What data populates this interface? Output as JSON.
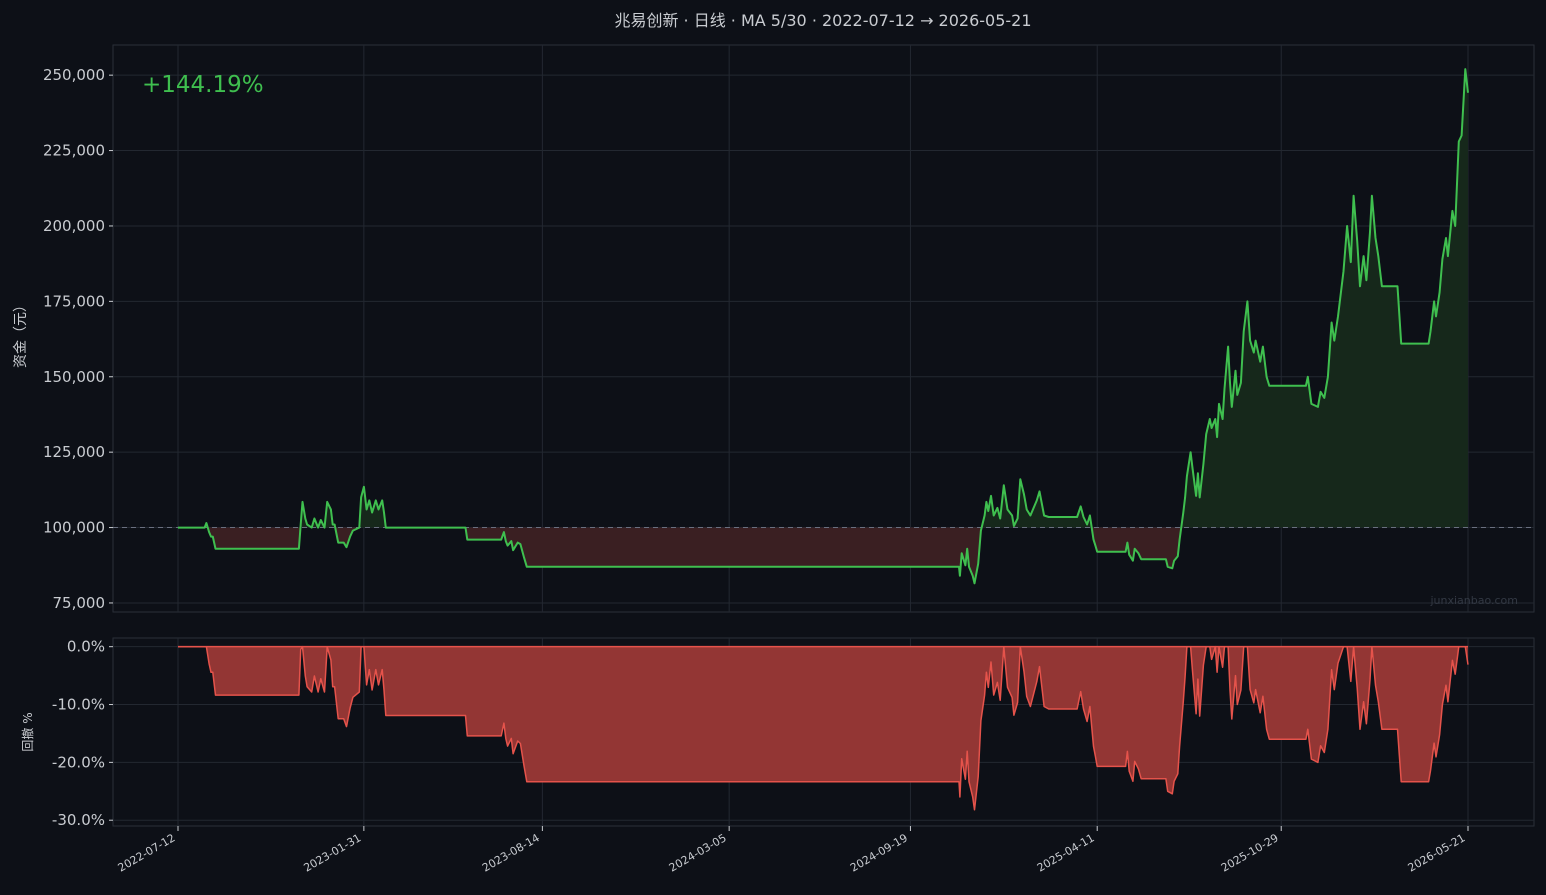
{
  "title": "兆易创新 · 日线 · MA 5/30 · 2022-07-12 → 2026-05-21",
  "return_label": "+144.19%",
  "watermark": "junxianbao.com",
  "colors": {
    "background": "#0d1017",
    "equity_line": "#3fbf4f",
    "gain_fill": "#16281b",
    "loss_fill": "#3a1f22",
    "drawdown": "#e5534b",
    "drawdown_fill": "#933634",
    "grid": "#232831",
    "text": "#c9ccd1",
    "baseline": "#6a7080"
  },
  "chart_data": [
    {
      "type": "line",
      "name": "equity",
      "ylabel": "资金（元）",
      "ylim": [
        72000,
        260000
      ],
      "yticks": [
        75000,
        100000,
        125000,
        150000,
        175000,
        200000,
        225000,
        250000
      ],
      "ytick_labels": [
        "75,000",
        "100,000",
        "125,000",
        "150,000",
        "175,000",
        "200,000",
        "225,000",
        "250,000"
      ],
      "baseline": 100000,
      "x_start": "2022-07-12",
      "x_end": "2026-05-21",
      "points": [
        [
          "2022-07-12",
          100000
        ],
        [
          "2022-08-10",
          100000
        ],
        [
          "2022-08-12",
          101500
        ],
        [
          "2022-08-15",
          98500
        ],
        [
          "2022-08-17",
          97000
        ],
        [
          "2022-08-19",
          97000
        ],
        [
          "2022-08-22",
          93000
        ],
        [
          "2022-11-21",
          93000
        ],
        [
          "2022-11-23",
          101000
        ],
        [
          "2022-11-25",
          108500
        ],
        [
          "2022-11-28",
          103000
        ],
        [
          "2022-11-30",
          101000
        ],
        [
          "2022-12-05",
          100000
        ],
        [
          "2022-12-08",
          103000
        ],
        [
          "2022-12-12",
          100000
        ],
        [
          "2022-12-15",
          102500
        ],
        [
          "2022-12-19",
          100000
        ],
        [
          "2022-12-22",
          108500
        ],
        [
          "2022-12-26",
          106000
        ],
        [
          "2022-12-28",
          101000
        ],
        [
          "2022-12-30",
          101000
        ],
        [
          "2023-01-03",
          95000
        ],
        [
          "2023-01-09",
          95000
        ],
        [
          "2023-01-12",
          93500
        ],
        [
          "2023-01-16",
          97000
        ],
        [
          "2023-01-19",
          99000
        ],
        [
          "2023-01-26",
          100000
        ],
        [
          "2023-01-28",
          110000
        ],
        [
          "2023-01-31",
          113500
        ],
        [
          "2023-02-03",
          106000
        ],
        [
          "2023-02-06",
          109000
        ],
        [
          "2023-02-09",
          105000
        ],
        [
          "2023-02-13",
          109000
        ],
        [
          "2023-02-16",
          106000
        ],
        [
          "2023-02-20",
          109000
        ],
        [
          "2023-02-22",
          105000
        ],
        [
          "2023-02-24",
          100000
        ],
        [
          "2023-05-22",
          100000
        ],
        [
          "2023-05-24",
          96000
        ],
        [
          "2023-06-30",
          96000
        ],
        [
          "2023-07-03",
          98500
        ],
        [
          "2023-07-05",
          95500
        ],
        [
          "2023-07-07",
          94000
        ],
        [
          "2023-07-11",
          95500
        ],
        [
          "2023-07-13",
          92500
        ],
        [
          "2023-07-18",
          95000
        ],
        [
          "2023-07-21",
          94500
        ],
        [
          "2023-07-25",
          90000
        ],
        [
          "2023-07-28",
          87000
        ],
        [
          "2023-08-01",
          87000
        ],
        [
          "2024-11-11",
          87000
        ],
        [
          "2024-11-12",
          84000
        ],
        [
          "2024-11-14",
          91500
        ],
        [
          "2024-11-18",
          87500
        ],
        [
          "2024-11-20",
          93000
        ],
        [
          "2024-11-22",
          87000
        ],
        [
          "2024-11-26",
          84000
        ],
        [
          "2024-11-28",
          81500
        ],
        [
          "2024-12-02",
          88000
        ],
        [
          "2024-12-05",
          99000
        ],
        [
          "2024-12-09",
          104000
        ],
        [
          "2024-12-11",
          108500
        ],
        [
          "2024-12-13",
          105500
        ],
        [
          "2024-12-16",
          110500
        ],
        [
          "2024-12-19",
          104000
        ],
        [
          "2024-12-23",
          106500
        ],
        [
          "2024-12-26",
          103000
        ],
        [
          "2024-12-30",
          114000
        ],
        [
          "2025-01-03",
          106000
        ],
        [
          "2025-01-08",
          104000
        ],
        [
          "2025-01-10",
          100500
        ],
        [
          "2025-01-14",
          103000
        ],
        [
          "2025-01-17",
          116000
        ],
        [
          "2025-01-21",
          111000
        ],
        [
          "2025-01-24",
          106000
        ],
        [
          "2025-01-28",
          104000
        ],
        [
          "2025-02-04",
          109000
        ],
        [
          "2025-02-07",
          112000
        ],
        [
          "2025-02-12",
          104000
        ],
        [
          "2025-02-17",
          103500
        ],
        [
          "2025-03-20",
          103500
        ],
        [
          "2025-03-24",
          107000
        ],
        [
          "2025-03-27",
          103500
        ],
        [
          "2025-03-31",
          101000
        ],
        [
          "2025-04-03",
          104000
        ],
        [
          "2025-04-07",
          96000
        ],
        [
          "2025-04-09",
          94000
        ],
        [
          "2025-04-11",
          92000
        ],
        [
          "2025-05-12",
          92000
        ],
        [
          "2025-05-14",
          95000
        ],
        [
          "2025-05-16",
          91000
        ],
        [
          "2025-05-20",
          89000
        ],
        [
          "2025-05-22",
          93000
        ],
        [
          "2025-05-26",
          91500
        ],
        [
          "2025-05-29",
          89500
        ],
        [
          "2025-06-25",
          89500
        ],
        [
          "2025-06-27",
          87000
        ],
        [
          "2025-07-02",
          86500
        ],
        [
          "2025-07-04",
          89000
        ],
        [
          "2025-07-08",
          90500
        ],
        [
          "2025-07-10",
          96000
        ],
        [
          "2025-07-14",
          105000
        ],
        [
          "2025-07-16",
          110000
        ],
        [
          "2025-07-18",
          117000
        ],
        [
          "2025-07-22",
          125000
        ],
        [
          "2025-07-24",
          120000
        ],
        [
          "2025-07-28",
          110500
        ],
        [
          "2025-07-30",
          118000
        ],
        [
          "2025-08-01",
          110000
        ],
        [
          "2025-08-05",
          121000
        ],
        [
          "2025-08-08",
          131000
        ],
        [
          "2025-08-12",
          136000
        ],
        [
          "2025-08-14",
          133000
        ],
        [
          "2025-08-18",
          136000
        ],
        [
          "2025-08-20",
          130000
        ],
        [
          "2025-08-22",
          141000
        ],
        [
          "2025-08-26",
          136000
        ],
        [
          "2025-08-28",
          146000
        ],
        [
          "2025-09-01",
          160000
        ],
        [
          "2025-09-03",
          148000
        ],
        [
          "2025-09-05",
          140000
        ],
        [
          "2025-09-09",
          152000
        ],
        [
          "2025-09-11",
          144000
        ],
        [
          "2025-09-15",
          148000
        ],
        [
          "2025-09-18",
          165000
        ],
        [
          "2025-09-22",
          175000
        ],
        [
          "2025-09-25",
          162000
        ],
        [
          "2025-09-29",
          158000
        ],
        [
          "2025-10-01",
          162000
        ],
        [
          "2025-10-06",
          155000
        ],
        [
          "2025-10-09",
          160000
        ],
        [
          "2025-10-13",
          150000
        ],
        [
          "2025-10-16",
          147000
        ],
        [
          "2025-11-25",
          147000
        ],
        [
          "2025-11-27",
          150000
        ],
        [
          "2025-12-01",
          141000
        ],
        [
          "2025-12-08",
          140000
        ],
        [
          "2025-12-11",
          145000
        ],
        [
          "2025-12-15",
          143000
        ],
        [
          "2025-12-19",
          150000
        ],
        [
          "2025-12-23",
          168000
        ],
        [
          "2025-12-26",
          162000
        ],
        [
          "2025-12-30",
          170000
        ],
        [
          "2026-01-05",
          185000
        ],
        [
          "2026-01-09",
          200000
        ],
        [
          "2026-01-13",
          188000
        ],
        [
          "2026-01-16",
          210000
        ],
        [
          "2026-01-20",
          195000
        ],
        [
          "2026-01-23",
          180000
        ],
        [
          "2026-01-27",
          190000
        ],
        [
          "2026-01-30",
          182000
        ],
        [
          "2026-02-03",
          198000
        ],
        [
          "2026-02-05",
          210000
        ],
        [
          "2026-02-09",
          196000
        ],
        [
          "2026-02-12",
          190000
        ],
        [
          "2026-02-16",
          180000
        ],
        [
          "2026-03-05",
          180000
        ],
        [
          "2026-03-09",
          161000
        ],
        [
          "2026-04-08",
          161000
        ],
        [
          "2026-04-10",
          165000
        ],
        [
          "2026-04-14",
          175000
        ],
        [
          "2026-04-16",
          170000
        ],
        [
          "2026-04-20",
          178000
        ],
        [
          "2026-04-23",
          189000
        ],
        [
          "2026-04-27",
          196000
        ],
        [
          "2026-04-29",
          190000
        ],
        [
          "2026-05-04",
          205000
        ],
        [
          "2026-05-07",
          200000
        ],
        [
          "2026-05-11",
          228000
        ],
        [
          "2026-05-14",
          230000
        ],
        [
          "2026-05-18",
          252000
        ],
        [
          "2026-05-21",
          244190
        ]
      ]
    },
    {
      "type": "area",
      "name": "drawdown",
      "ylabel": "回撤 %",
      "ylim": [
        -31,
        1.5
      ],
      "yticks": [
        0,
        -10,
        -20,
        -30
      ],
      "ytick_labels": [
        "0.0%",
        "-10.0%",
        "-20.0%",
        "-30.0%"
      ],
      "xticks": [
        "2022-07-12",
        "2023-01-31",
        "2023-08-14",
        "2024-03-05",
        "2024-09-19",
        "2025-04-11",
        "2025-10-29",
        "2026-05-21"
      ]
    }
  ]
}
